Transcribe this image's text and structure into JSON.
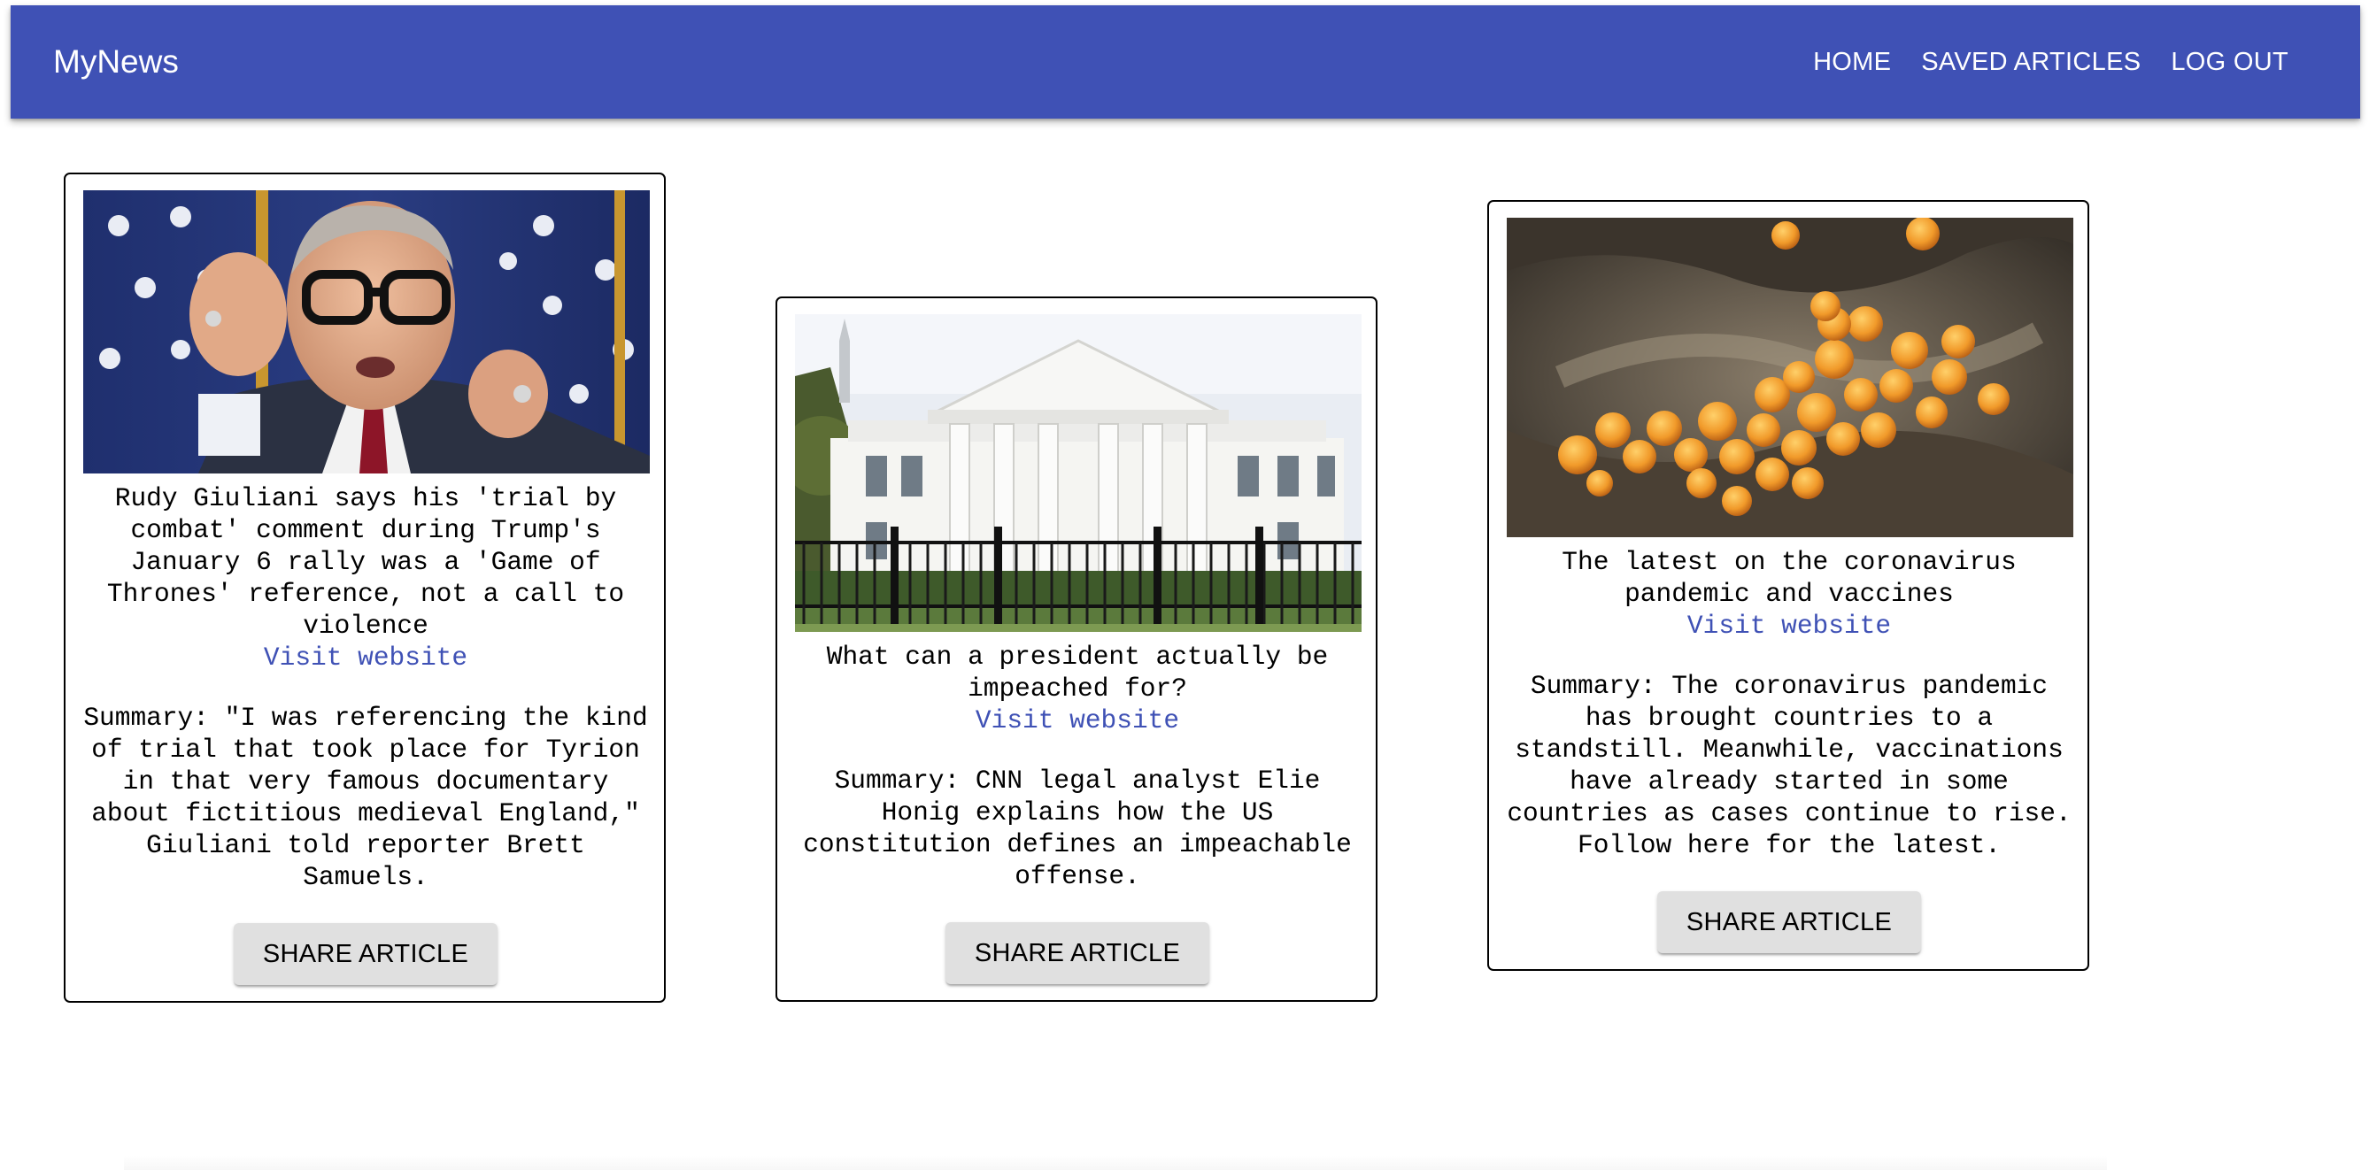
{
  "app": {
    "brand": "MyNews",
    "nav": [
      "HOME",
      "SAVED ARTICLES",
      "LOG OUT"
    ]
  },
  "articles": [
    {
      "image": "rudy-giuliani-photo",
      "title": "Rudy Giuliani says his 'trial by combat' comment during Trump's January 6 rally was a 'Game of Thrones' reference, not a call to violence",
      "link_label": "Visit website",
      "summary": "Summary: \"I was referencing the kind of trial that took place for Tyrion in that very famous documentary about fictitious medieval England,\" Giuliani told reporter Brett Samuels.",
      "button": "SHARE ARTICLE"
    },
    {
      "image": "white-house-photo",
      "title": "What can a president actually be impeached for?",
      "link_label": "Visit website",
      "summary": "Summary: CNN legal analyst Elie Honig explains how the US constitution defines an impeachable offense.",
      "button": "SHARE ARTICLE"
    },
    {
      "image": "coronavirus-micrograph",
      "title": "The latest on the coronavirus pandemic and vaccines",
      "link_label": "Visit website",
      "summary": "Summary: The coronavirus pandemic has brought countries to a standstill. Meanwhile, vaccinations have already started in some countries as cases continue to rise. Follow here for the latest.",
      "button": "SHARE ARTICLE"
    }
  ],
  "colors": {
    "appbar": "#3f51b5",
    "link": "#3f51b5",
    "button_bg": "#e0e0e0"
  }
}
